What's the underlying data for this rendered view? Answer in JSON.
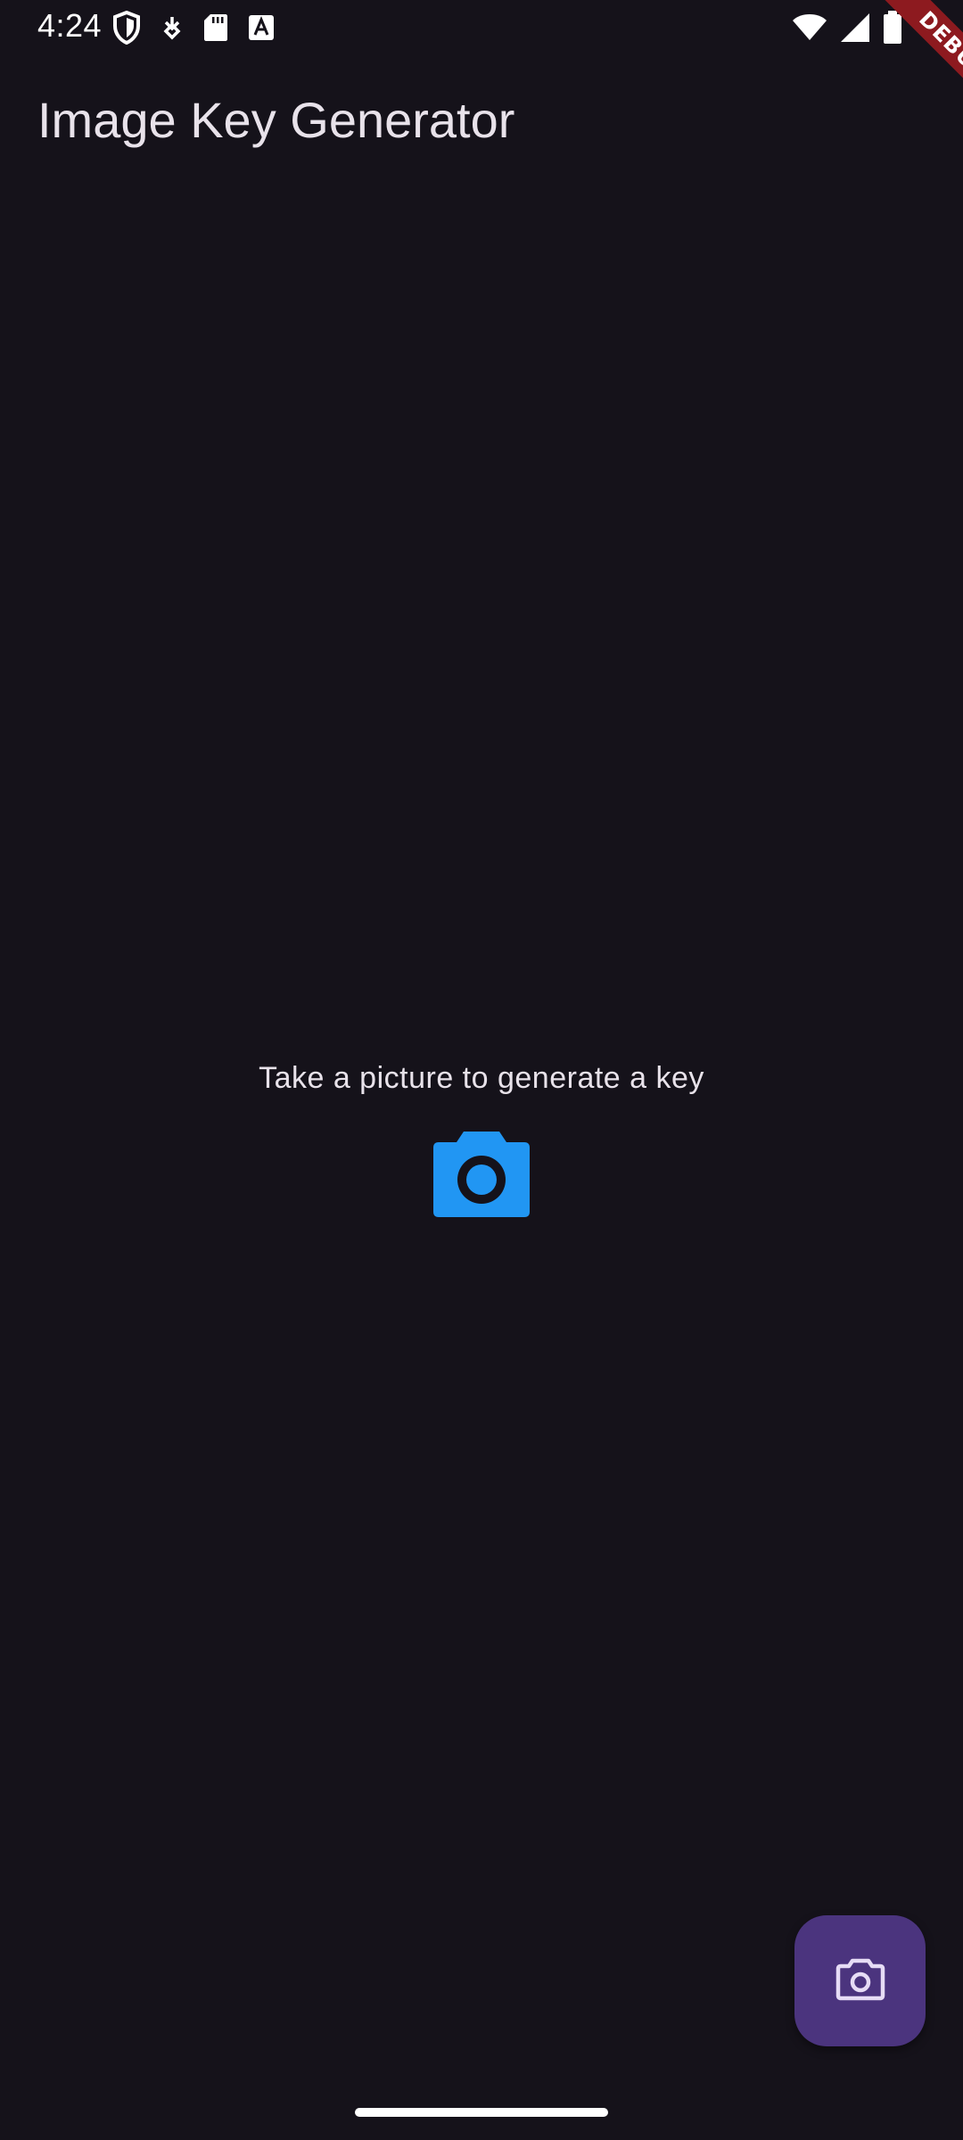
{
  "status_bar": {
    "time": "4:24",
    "left_icons": [
      "shield-icon",
      "download-icon",
      "sd-card-icon",
      "font-a-icon"
    ],
    "right_icons": [
      "wifi-icon",
      "cell-signal-icon",
      "battery-icon"
    ]
  },
  "debug_banner": {
    "label": "DEBUG",
    "color": "#8d1a1f"
  },
  "app_bar": {
    "title": "Image Key Generator"
  },
  "main": {
    "prompt": "Take a picture to generate a key",
    "camera_icon": "camera-icon",
    "camera_icon_color": "#2196f3"
  },
  "fab": {
    "icon": "camera-outline-icon",
    "background": "#4b347e"
  },
  "colors": {
    "background": "#15121a",
    "text": "#e8e2ea"
  }
}
